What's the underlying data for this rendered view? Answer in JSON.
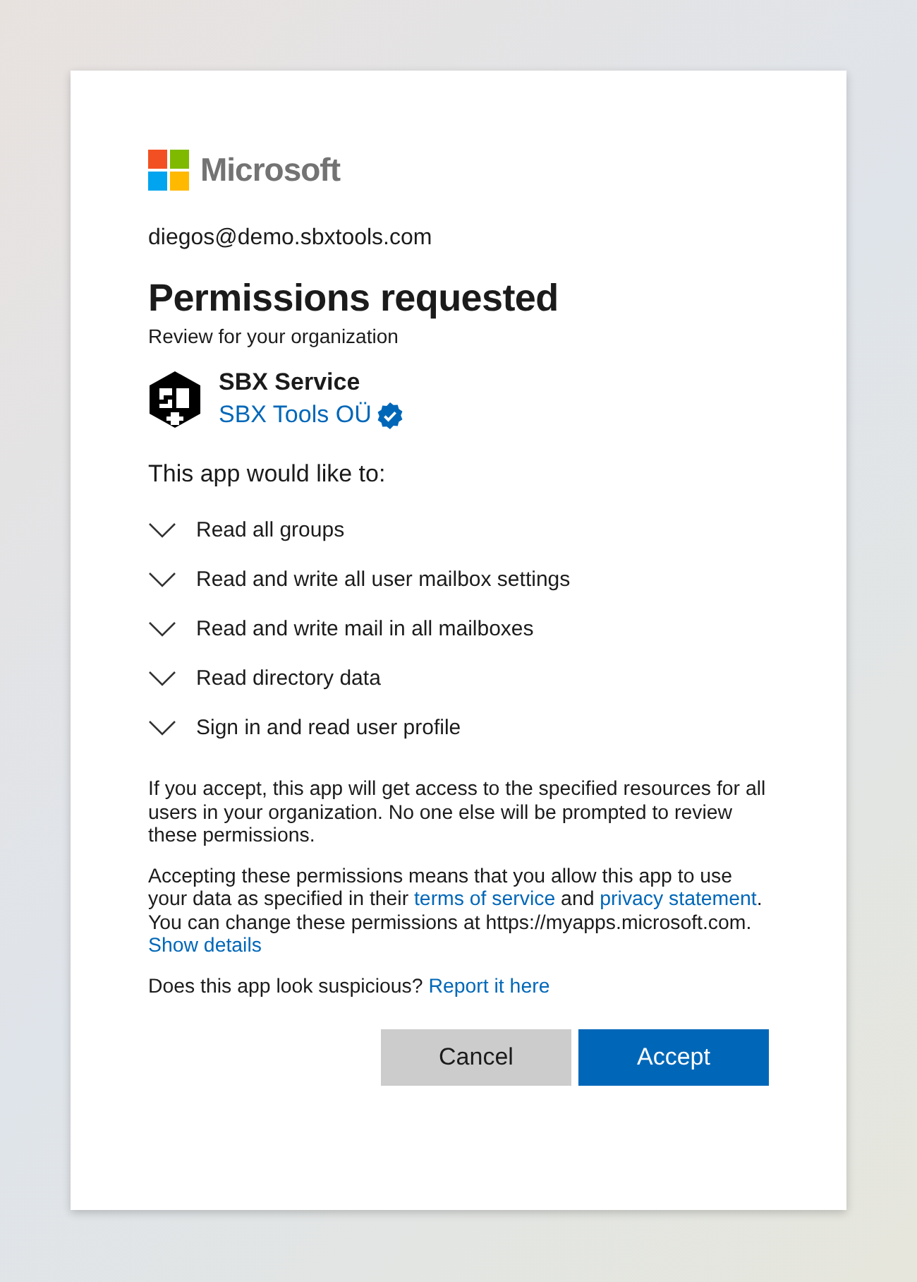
{
  "brand": "Microsoft",
  "account": "diegos@demo.sbxtools.com",
  "title": "Permissions requested",
  "subtitle": "Review for your organization",
  "app": {
    "name": "SBX Service",
    "publisher": "SBX Tools OÜ",
    "verified": true
  },
  "intro": "This app would like to:",
  "permissions": [
    {
      "label": "Read all groups",
      "expanded": false
    },
    {
      "label": "Read and write all user mailbox settings",
      "expanded": false
    },
    {
      "label": "Read and write mail in all mailboxes",
      "expanded": false
    },
    {
      "label": "Read directory data",
      "expanded": false
    },
    {
      "label": "Sign in and read user profile",
      "expanded": false
    }
  ],
  "paragraphs": [
    [
      {
        "kind": "text",
        "text": "If you accept, this app will get access to the specified resources for all users in your organization. No one else will be prompted to review these permissions."
      }
    ],
    [
      {
        "kind": "text",
        "text": "Accepting these permissions means that you allow this app to use your data as specified in their "
      },
      {
        "kind": "link",
        "text": "terms of service"
      },
      {
        "kind": "text",
        "text": " and "
      },
      {
        "kind": "link",
        "text": "privacy statement"
      },
      {
        "kind": "text",
        "text": ". You can change these permissions at https://myapps.microsoft.com. "
      },
      {
        "kind": "link",
        "text": "Show details"
      }
    ],
    [
      {
        "kind": "text",
        "text": "Does this app look suspicious? "
      },
      {
        "kind": "link",
        "text": "Report it here"
      }
    ]
  ],
  "buttons": [
    {
      "label": "Cancel",
      "kind": "secondary"
    },
    {
      "label": "Accept",
      "kind": "primary"
    }
  ]
}
